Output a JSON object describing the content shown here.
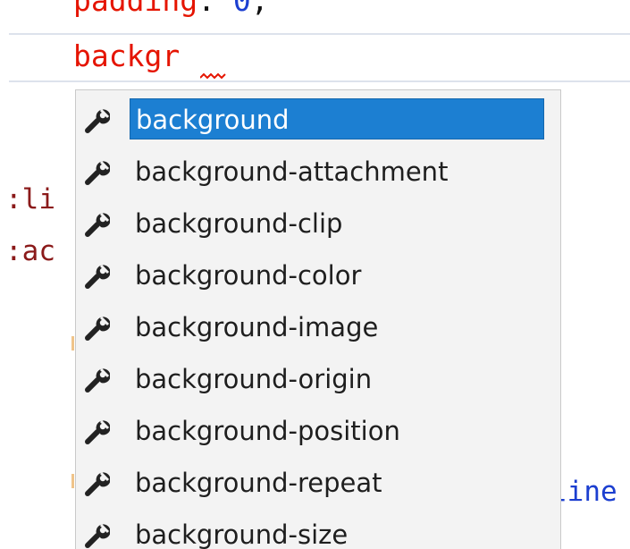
{
  "editor": {
    "previous_line": {
      "property": "padding",
      "colon": ":",
      "value": "0",
      "terminator": ";"
    },
    "current_line": {
      "typed_text": "backgr"
    },
    "background_fragments": {
      "li": ":li",
      "ac": ":ac",
      "line": "line"
    }
  },
  "completion": {
    "selected_index": 0,
    "icon": "wrench-icon",
    "accent_color": "#1c7fd2",
    "items": [
      {
        "label": "background"
      },
      {
        "label": "background-attachment"
      },
      {
        "label": "background-clip"
      },
      {
        "label": "background-color"
      },
      {
        "label": "background-image"
      },
      {
        "label": "background-origin"
      },
      {
        "label": "background-position"
      },
      {
        "label": "background-repeat"
      },
      {
        "label": "background-size"
      }
    ]
  }
}
